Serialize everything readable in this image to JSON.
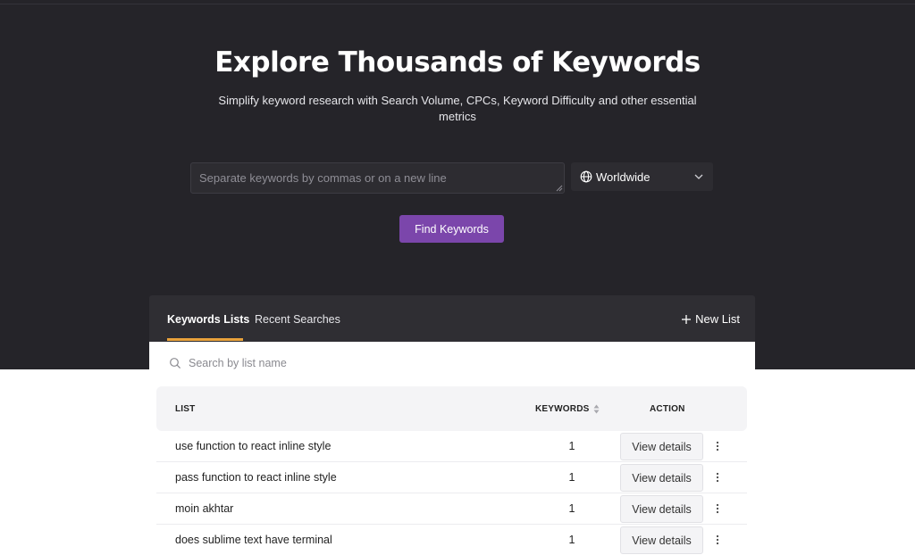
{
  "hero": {
    "title": "Explore Thousands of Keywords",
    "subtitle": "Simplify keyword research with Search Volume, CPCs, Keyword Difficulty and other essential metrics"
  },
  "search": {
    "keywords_placeholder": "Separate keywords by commas or on a new line",
    "region_icon": "globe-icon",
    "region_value": "Worldwide",
    "find_button": "Find Keywords"
  },
  "panel": {
    "tabs": [
      {
        "label": "Keywords Lists",
        "active": true
      },
      {
        "label": "Recent Searches",
        "active": false
      }
    ],
    "new_list_label": "New List",
    "list_search_placeholder": "Search by list name",
    "columns": {
      "list": "LIST",
      "keywords": "KEYWORDS",
      "action": "ACTION"
    },
    "rows": [
      {
        "name": "use function to react inline style",
        "keywords": "1",
        "action": "View details"
      },
      {
        "name": "pass function to react inline style",
        "keywords": "1",
        "action": "View details"
      },
      {
        "name": "moin akhtar",
        "keywords": "1",
        "action": "View details"
      },
      {
        "name": "does sublime text have terminal",
        "keywords": "1",
        "action": "View details"
      }
    ]
  },
  "colors": {
    "hero_background": "#252429",
    "accent_purple": "#7b46ab",
    "tab_underline": "#e9a23b"
  }
}
